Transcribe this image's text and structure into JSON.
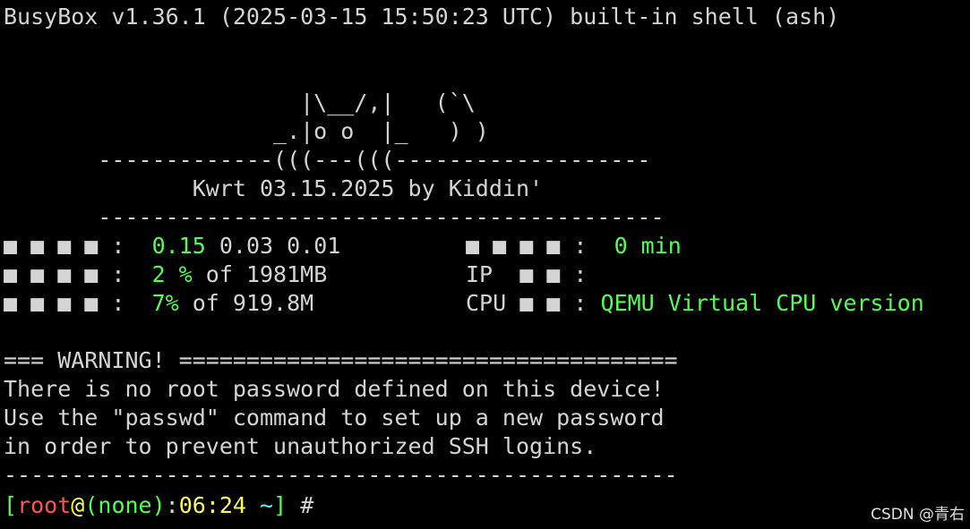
{
  "terminal": {
    "header": "BusyBox v1.36.1 (2025-03-15 15:50:23 UTC) built-in shell (ash)",
    "banner": {
      "art_line_1": "                      |\\__/,|   (`\\",
      "art_line_2": "                    _.|o o  |_   ) )",
      "divider_top": "       -------------(((---(((-------------------",
      "title": "              Kwrt 03.15.2025 by Kiddin'",
      "divider_bottom": "       ------------------------------------------"
    },
    "stats": {
      "row1": {
        "label": "■ ■ ■ ■ :  ",
        "value": "0.15",
        "rest": " 0.03 0.01",
        "right_label": "■ ■ ■ ■ :  ",
        "right_value": "0 min"
      },
      "row2": {
        "label": "■ ■ ■ ■ :  ",
        "value": "2 %",
        "rest": " of 1981MB",
        "right_label": "IP  ■ ■ :"
      },
      "row3": {
        "label": "■ ■ ■ ■ :  ",
        "value": "7%",
        "rest": " of 919.8M",
        "right_label": "CPU ■ ■ : ",
        "right_value": "QEMU Virtual CPU version"
      }
    },
    "warning": {
      "header": "=== WARNING! =====================================",
      "line1": "There is no root password defined on this device!",
      "line2": "Use the \"passwd\" command to set up a new password",
      "line3": "in order to prevent unauthorized SSH logins.",
      "footer": "--------------------------------------------------"
    },
    "prompt": {
      "open": "[",
      "user": "root",
      "at": "@",
      "host": "(none)",
      "colon": ":",
      "time": "06:24",
      "cwd": " ~",
      "close": "]",
      "symbol": " #"
    }
  },
  "watermark": "CSDN @青右"
}
